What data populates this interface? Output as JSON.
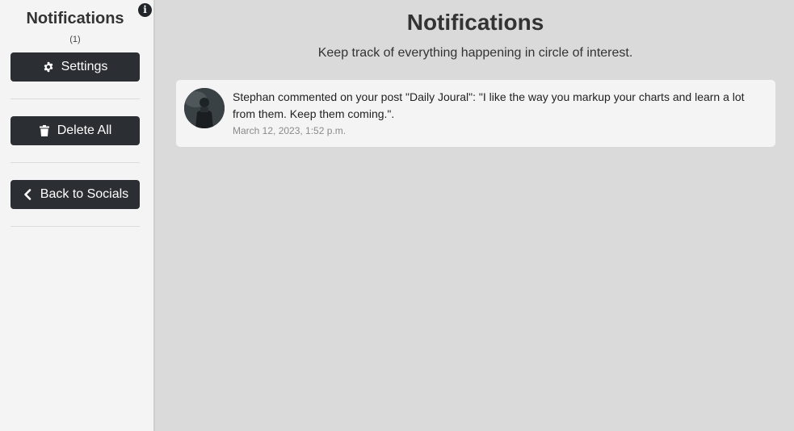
{
  "sidebar": {
    "title": "Notifications",
    "count": "(1)",
    "info_icon": "i",
    "buttons": [
      {
        "label": "Settings",
        "icon": "gear-icon"
      },
      {
        "label": "Delete All",
        "icon": "trash-icon"
      },
      {
        "label": "Back to Socials",
        "icon": "chevron-left-icon"
      }
    ]
  },
  "main": {
    "title": "Notifications",
    "subtitle": "Keep track of everything happening in circle of interest.",
    "notifications": [
      {
        "text": "Stephan commented on your post \"Daily Joural\": \"I like the way you markup your charts and learn a lot from them. Keep them coming.\".",
        "timestamp": "March 12, 2023, 1:52 p.m."
      }
    ]
  },
  "colors": {
    "button_bg": "#2b2e33",
    "sidebar_bg": "#f4f4f4",
    "main_bg": "#dadada"
  }
}
